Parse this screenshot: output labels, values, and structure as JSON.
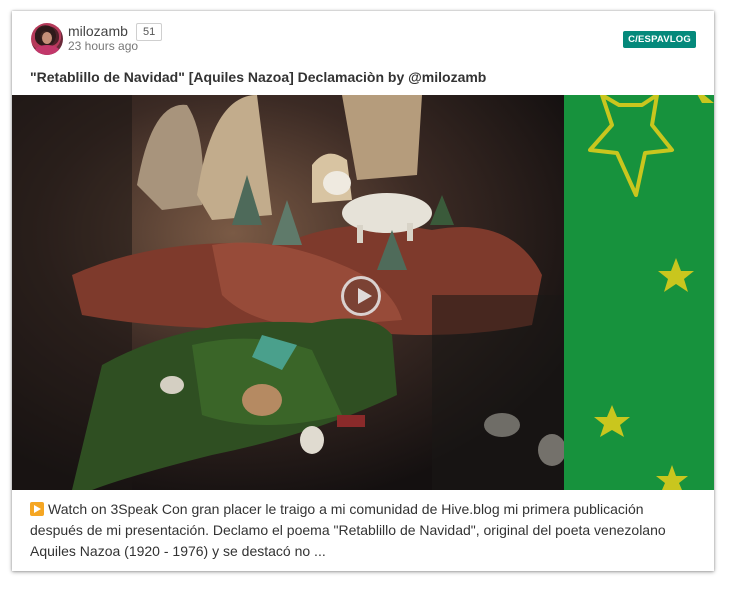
{
  "post": {
    "author": "milozamb",
    "reputation": "51",
    "time": "23 hours ago",
    "community": "C/ESPAVLOG",
    "title": "\"Retablillo de Navidad\" [Aquiles Nazoa] Declamaciòn by @milozamb",
    "description": "Watch on 3Speak Con gran placer le traigo a mi comunidad de Hive.blog mi primera publicación después de mi presentación. Declamo el poema \"Retablillo de Navidad\", original del poeta venezolano Aquiles Nazoa (1920 - 1976) y se destacó no ..."
  },
  "icons": {
    "play_overlay": "play-circle-icon",
    "watch_emoji": "play-button-emoji-icon"
  },
  "colors": {
    "community_badge": "#05897b",
    "panel_green": "#17923d",
    "star_yellow": "#c9c61e"
  }
}
